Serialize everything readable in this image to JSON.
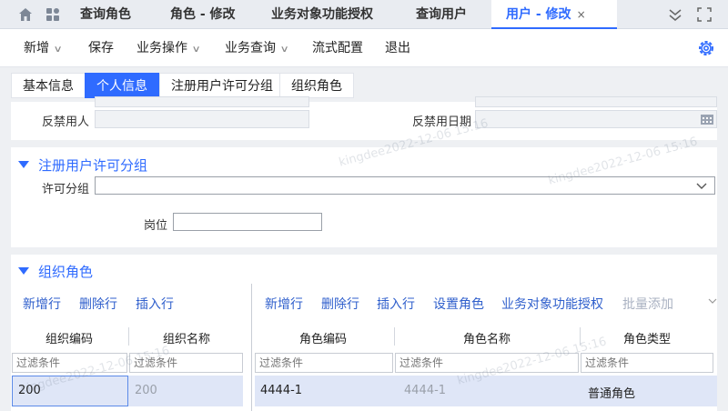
{
  "top_tabs": [
    {
      "label": "查询角色"
    },
    {
      "label": "角色 - 修改"
    },
    {
      "label": "业务对象功能授权"
    },
    {
      "label": "查询用户"
    },
    {
      "label": "用户 - 修改",
      "close": "×"
    }
  ],
  "toolbar": {
    "new": "新增",
    "save": "保存",
    "business_ops": "业务操作",
    "business_query": "业务查询",
    "flow_config": "流式配置",
    "exit": "退出"
  },
  "sub_tabs": [
    "基本信息",
    "个人信息",
    "注册用户许可分组",
    "组织角色"
  ],
  "ban_section": {
    "ban_user_label": "反禁用人",
    "ban_date_label": "反禁用日期"
  },
  "license_section": {
    "title": "注册用户许可分组",
    "license_group_label": "许可分组",
    "license_group_value": "",
    "position_label": "岗位",
    "position_value": ""
  },
  "org_role_section": {
    "title": "组织角色",
    "left_grid": {
      "buttons": [
        "新增行",
        "删除行",
        "插入行"
      ],
      "headers": [
        "组织编码",
        "组织名称"
      ],
      "filter_placeholder": "过滤条件",
      "rows": [
        [
          "200",
          "200"
        ]
      ]
    },
    "right_grid": {
      "buttons": [
        "新增行",
        "删除行",
        "插入行",
        "设置角色",
        "业务对象功能授权"
      ],
      "disabled_button": "批量添加",
      "headers": [
        "角色编码",
        "角色名称",
        "角色类型"
      ],
      "filter_placeholder": "过滤条件",
      "rows": [
        [
          "4444-1",
          "4444-1",
          "普通角色"
        ]
      ]
    }
  },
  "watermark": "kingdee2022-12-06 15:16",
  "colors": {
    "accent": "#2f6bff",
    "selected_row": "#dfe6f7"
  }
}
